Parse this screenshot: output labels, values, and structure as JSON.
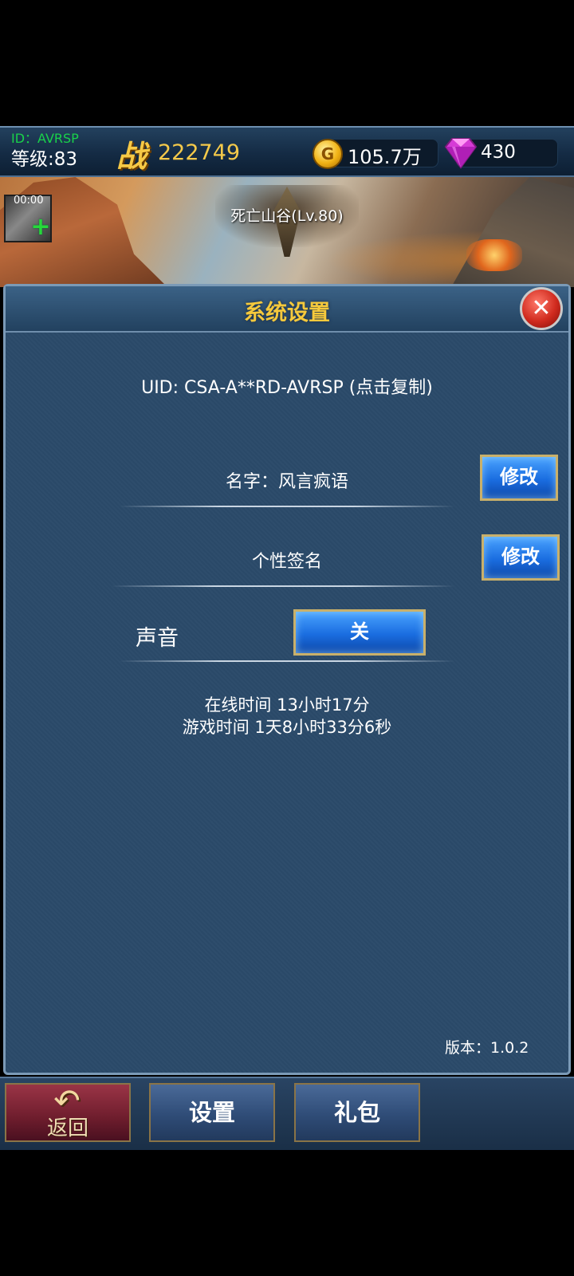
{
  "status_bar": {
    "player_id": "ID：AVRSP",
    "level": "等级:83",
    "power_glyph": "战",
    "power_value": "222749",
    "gold_icon_letter": "G",
    "gold_value": "105.7万",
    "gem_value": "430"
  },
  "scene": {
    "timer": "00:00",
    "map_name": "死亡山谷(Lv.80)"
  },
  "panel": {
    "title": "系统设置",
    "uid": "UID: CSA-A**RD-AVRSP (点击复制)",
    "name_row": {
      "label": "名字：风言疯语",
      "button": "修改"
    },
    "signature_row": {
      "label": "个性签名",
      "button": "修改"
    },
    "sound_row": {
      "label": "声音",
      "toggle": "关"
    },
    "online_time": "在线时间 13小时17分",
    "play_time": "游戏时间 1天8小时33分6秒",
    "version": "版本：1.0.2"
  },
  "bottom_bar": {
    "back_label": "返回",
    "settings_label": "设置",
    "gift_label": "礼包"
  },
  "icons": {
    "gold": "gold-coin-icon",
    "gem": "diamond-icon",
    "close": "close-icon",
    "back": "back-arrow-icon"
  },
  "colors": {
    "panel_bg": "#2b4a6a",
    "title_gold": "#f5c93c",
    "player_id_green": "#19d14a",
    "button_blue": "#1a6de0"
  }
}
